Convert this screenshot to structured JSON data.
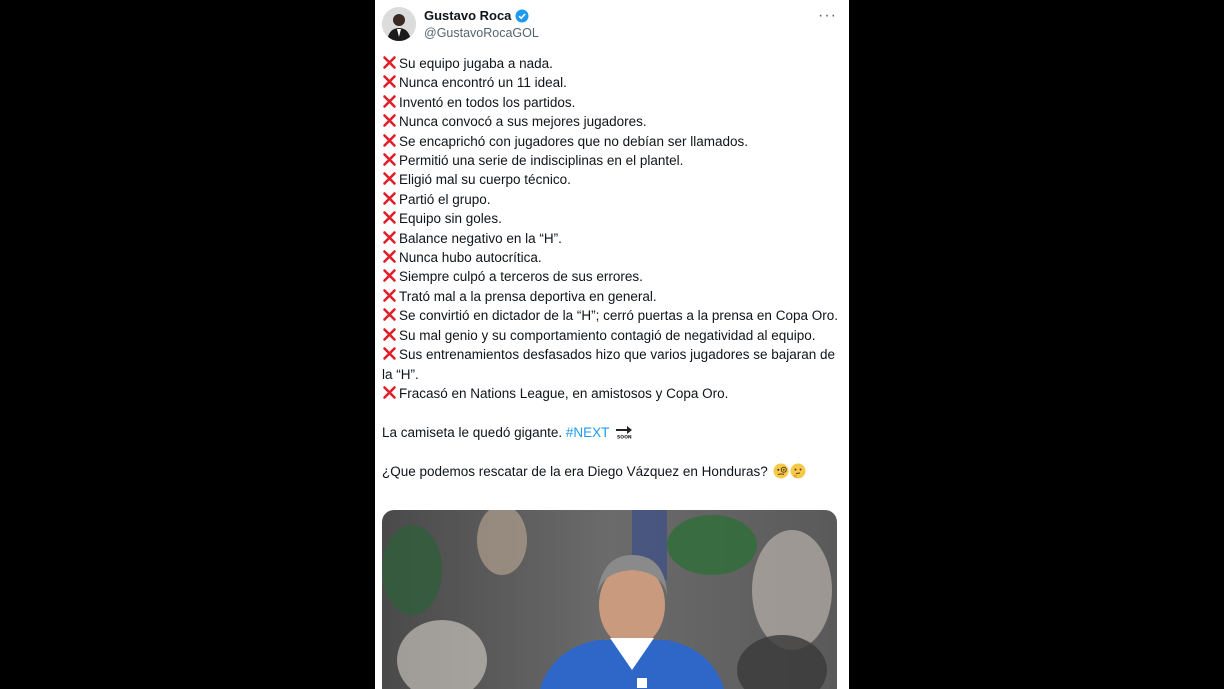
{
  "tweet": {
    "author_name": "Gustavo Roca",
    "author_handle": "@GustavoRocaGOL",
    "more_label": "···",
    "lines": [
      "Su equipo jugaba a nada.",
      "Nunca encontró un 11 ideal.",
      "Inventó en todos los partidos.",
      "Nunca convocó a sus mejores jugadores.",
      "Se encaprichó con jugadores que no debían ser llamados.",
      "Permitió una serie de indisciplinas en el plantel.",
      "Eligió mal su cuerpo técnico.",
      "Partió el grupo.",
      "Equipo sin goles.",
      "Balance negativo en la “H”.",
      "Nunca hubo autocrítica.",
      "Siempre culpó a terceros de sus errores.",
      "Trató mal a la prensa deportiva en general.",
      "Se convirtió en dictador de la “H”; cerró puertas a la prensa en Copa Oro.",
      "Su mal genio y su comportamiento contagió de negatividad al equipo.",
      "Sus entrenamientos desfasados hizo que varios jugadores se bajaran de la “H”.",
      "Fracasó en Nations League, en amistosos y Copa Oro."
    ],
    "closing_text": "La camiseta le quedó gigante.",
    "hashtag": "#NEXT",
    "question": "¿Que podemos rescatar de la era Diego Vázquez en Honduras?",
    "colors": {
      "accent": "#1d9bf0",
      "cross": "#e0202a",
      "text": "#0f1419",
      "secondary": "#536471"
    },
    "icons": [
      "verified-badge-icon",
      "more-icon",
      "cross-mark-icon",
      "soon-arrow-icon",
      "monocle-face-emoji",
      "thinking-face-emoji"
    ]
  }
}
